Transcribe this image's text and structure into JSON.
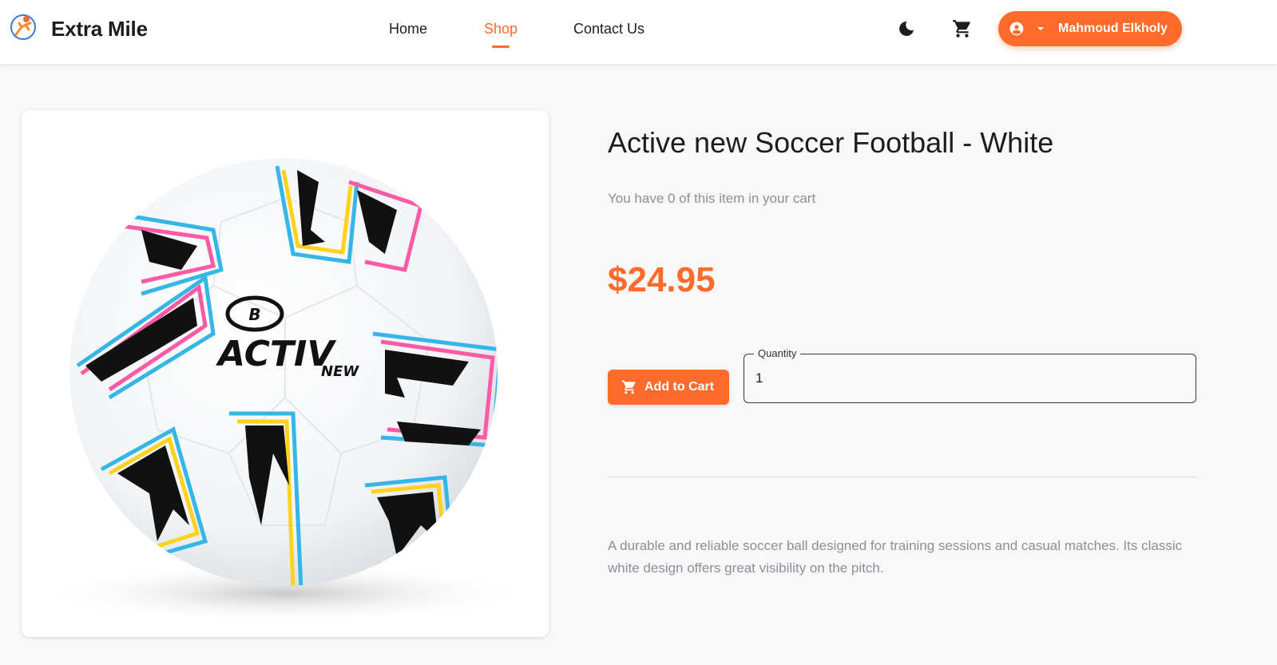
{
  "header": {
    "brand": "Extra Mile",
    "nav": [
      {
        "label": "Home",
        "active": false
      },
      {
        "label": "Shop",
        "active": true
      },
      {
        "label": "Contact Us",
        "active": false
      }
    ],
    "theme_icon": "moon-icon",
    "cart_icon": "cart-icon",
    "user": {
      "name": "Mahmoud Elkholy",
      "icon": "account-circle-icon",
      "caret_icon": "caret-down-icon"
    }
  },
  "product": {
    "title": "Active new Soccer Football - White",
    "cart_note": "You have 0 of this item in your cart",
    "price": "$24.95",
    "add_to_cart_label": "Add to Cart",
    "quantity_label": "Quantity",
    "quantity_value": "1",
    "description": "A durable and reliable soccer ball designed for training sessions and casual matches. Its classic white design offers great visibility on the pitch.",
    "image_alt": "soccer-ball-image",
    "ball_brand": "ACTIV",
    "ball_subbrand": "NEW"
  },
  "colors": {
    "accent": "#ff6b2b",
    "text": "#1d1d1d",
    "muted": "#8a8f98",
    "background": "#f8f8f8"
  }
}
